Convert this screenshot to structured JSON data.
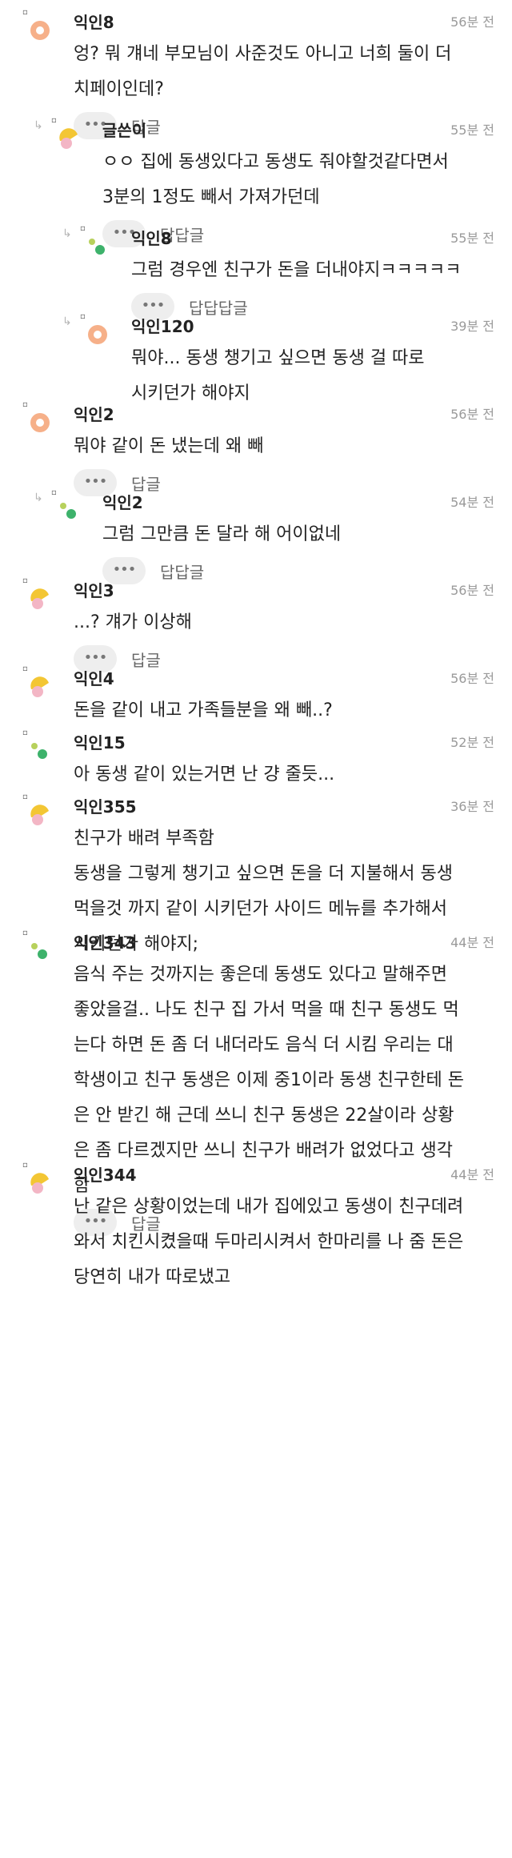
{
  "comments": [
    {
      "id": "c1",
      "level": 0,
      "avatar": "orange-ring",
      "name": "익인8",
      "time": "56분 전",
      "lines": [
        "엉? 뭐 걔네 부모님이 사준것도 아니고 너희 둘이 더",
        "치페이인데?"
      ],
      "reply_label": "답글"
    },
    {
      "id": "c2",
      "level": 1,
      "avatar": "yellow-pink",
      "name": "글쓴이",
      "time": "55분 전",
      "lines": [
        "ㅇㅇ 집에 동생있다고 동생도 줘야할것같다면서",
        "3분의 1정도 빼서 가져가던데"
      ],
      "reply_label": "답답글"
    },
    {
      "id": "c3",
      "level": 2,
      "avatar": "green-dots",
      "name": "익인8",
      "time": "55분 전",
      "lines": [
        "그럼 경우엔 친구가 돈을 더내야지ㅋㅋㅋㅋㅋ"
      ],
      "reply_label": "답답답글"
    },
    {
      "id": "c4",
      "level": 2,
      "avatar": "orange-ring",
      "name": "익인120",
      "time": "39분 전",
      "lines": [
        "뭐야... 동생 챙기고 싶으면 동생 걸 따로",
        "시키던가 해야지"
      ],
      "reply_label": ""
    },
    {
      "id": "c5",
      "level": 0,
      "avatar": "orange-ring",
      "name": "익인2",
      "time": "56분 전",
      "lines": [
        "뭐야 같이 돈 냈는데 왜 빼"
      ],
      "reply_label": "답글"
    },
    {
      "id": "c6",
      "level": 1,
      "avatar": "green-dots",
      "name": "익인2",
      "time": "54분 전",
      "lines": [
        "그럼 그만큼 돈 달라 해 어이없네"
      ],
      "reply_label": "답답글"
    },
    {
      "id": "c7",
      "level": 0,
      "avatar": "yellow-pink",
      "name": "익인3",
      "time": "56분 전",
      "lines": [
        "...? 걔가 이상해"
      ],
      "reply_label": "답글"
    },
    {
      "id": "c8",
      "level": 0,
      "avatar": "yellow-pink",
      "name": "익인4",
      "time": "56분 전",
      "lines": [
        "돈을 같이 내고 가족들분을 왜 빼..?"
      ],
      "reply_label": ""
    },
    {
      "id": "c9",
      "level": 0,
      "avatar": "green-dots",
      "name": "익인15",
      "time": "52분 전",
      "lines": [
        "아 동생 같이 있는거면 난 걍 줄듯..."
      ],
      "reply_label": ""
    },
    {
      "id": "c10",
      "level": 0,
      "avatar": "yellow-pink",
      "name": "익인355",
      "time": "36분 전",
      "lines": [
        "친구가 배려 부족함",
        "동생을 그렇게 챙기고 싶으면 돈을 더 지불해서 동생",
        "먹을것 까지 같이 시키던가 사이드 메뉴를 추가해서",
        "시키던가 해야지;"
      ],
      "reply_label": ""
    },
    {
      "id": "c11",
      "level": 0,
      "avatar": "green-dots",
      "name": "익인343",
      "time": "44분 전",
      "lines": [
        "음식 주는 것까지는 좋은데 동생도 있다고 말해주면",
        "좋았을걸.. 나도 친구 집 가서 먹을 때 친구 동생도 먹",
        "는다 하면 돈 좀 더 내더라도 음식 더 시킴 우리는 대",
        "학생이고 친구 동생은 이제 중1이라 동생 친구한테 돈",
        "은 안 받긴 해 근데 쓰니 친구 동생은 22살이라 상황",
        "은 좀 다르겠지만 쓰니 친구가 배려가 없었다고 생각",
        "함"
      ],
      "reply_label": "답글"
    },
    {
      "id": "c12",
      "level": 0,
      "avatar": "yellow-pink",
      "name": "익인344",
      "time": "44분 전",
      "lines": [
        "난 같은 상황이었는데 내가 집에있고 동생이 친구데려",
        "와서 치킨시켰을때 두마리시켜서 한마리를 나 줌 돈은",
        "당연히 내가 따로냈고"
      ],
      "reply_label": ""
    }
  ],
  "more_label": "•••"
}
